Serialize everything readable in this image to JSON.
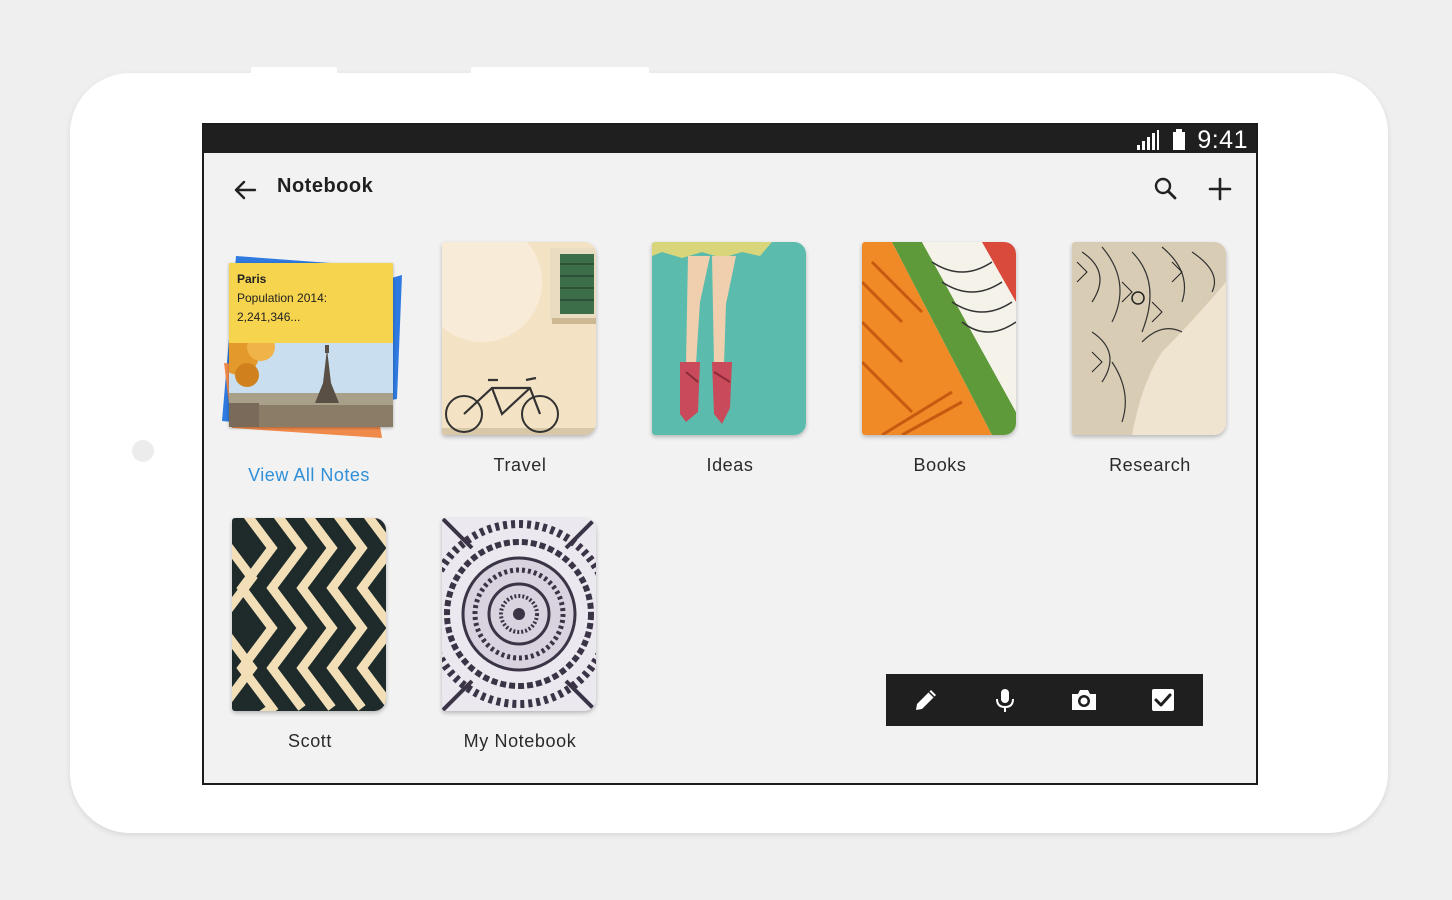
{
  "status_bar": {
    "time": "9:41"
  },
  "app_bar": {
    "title": "Notebook"
  },
  "notes_stack": {
    "title": "Paris",
    "line1": "Population 2014:",
    "line2": "2,241,346...",
    "link_label": "View All Notes"
  },
  "notebooks": [
    {
      "label": "Travel"
    },
    {
      "label": "Ideas"
    },
    {
      "label": "Books"
    },
    {
      "label": "Research"
    },
    {
      "label": "Scott"
    },
    {
      "label": "My Notebook"
    }
  ],
  "toolbar": {
    "icons": [
      "pencil-icon",
      "microphone-icon",
      "camera-icon",
      "checkbox-icon"
    ]
  },
  "colors": {
    "accent": "#2f8fd8",
    "status_bar": "#1f1f1f",
    "note_yellow": "#f7d44d"
  }
}
